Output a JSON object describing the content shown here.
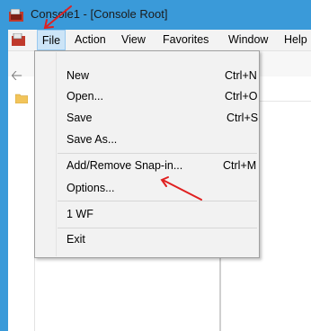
{
  "window": {
    "title": "Console1 - [Console Root]",
    "accent_color": "#3a9ad9",
    "app_icon": "mmc-console-icon"
  },
  "menubar": {
    "items": [
      "File",
      "Action",
      "View",
      "Favorites",
      "Window",
      "Help"
    ],
    "active": "File"
  },
  "toolbar": {
    "back_icon": "back-arrow-icon"
  },
  "tree": {
    "root_icon": "folder-icon"
  },
  "file_menu": {
    "items": [
      {
        "label": "New",
        "shortcut": "Ctrl+N"
      },
      {
        "label": "Open...",
        "shortcut": "Ctrl+O"
      },
      {
        "label": "Save",
        "shortcut": "Ctrl+S"
      },
      {
        "label": "Save As...",
        "shortcut": ""
      },
      {
        "label": "Add/Remove Snap-in...",
        "shortcut": "Ctrl+M"
      },
      {
        "label": "Options...",
        "shortcut": ""
      },
      {
        "label": "1 WF",
        "shortcut": ""
      },
      {
        "label": "Exit",
        "shortcut": ""
      }
    ]
  },
  "annotations": {
    "arrow_color": "#e02020"
  }
}
